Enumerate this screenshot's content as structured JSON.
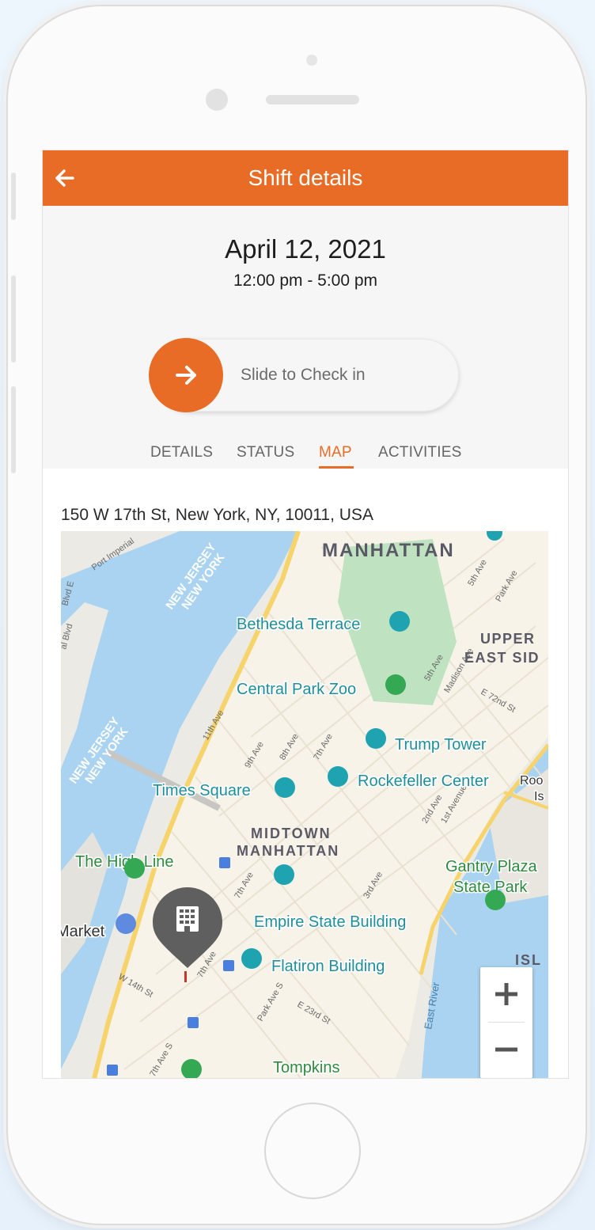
{
  "app": {
    "title": "Shift details",
    "accent_color": "#e86c25"
  },
  "shift": {
    "date": "April 12, 2021",
    "time_range": "12:00 pm - 5:00 pm"
  },
  "check_in": {
    "label": "Slide to Check in",
    "knob_icon": "arrow-right-icon"
  },
  "tabs": [
    {
      "label": "DETAILS",
      "active": false
    },
    {
      "label": "STATUS",
      "active": false
    },
    {
      "label": "MAP",
      "active": true
    },
    {
      "label": "ACTIVITIES",
      "active": false
    }
  ],
  "map": {
    "address": "150 W 17th St, New York, NY, 10011, USA",
    "areas": [
      "MANHATTAN",
      "UPPER",
      "EAST SID",
      "MIDTOWN",
      "MANHATTAN",
      "ISL"
    ],
    "state_labels": [
      "NEW JERSEY",
      "NEW YORK",
      "NEW JERSEY",
      "NEW YORK"
    ],
    "pois": [
      "Bethesda Terrace",
      "Central Park Zoo",
      "Trump Tower",
      "Times Square",
      "Rockefeller Center",
      "The High Line",
      "Gantry Plaza",
      "State Park",
      "Empire State Building",
      "Flatiron Building",
      "Tompkins",
      "Market",
      "Roo",
      "Is"
    ],
    "streets": [
      "Port Imperial",
      "Blvd E",
      "al Blvd",
      "11th Ave",
      "9th Ave",
      "8th Ave",
      "7th Ave",
      "5th Ave",
      "Park Ave",
      "5th Ave",
      "Madison Ave",
      "E 72nd St",
      "2nd Ave",
      "1st Avenue",
      "3rd Ave",
      "7th Ave",
      "W 14th St",
      "7th Ave",
      "Park Ave S",
      "E 23rd St",
      "7th Ave S",
      "East River"
    ],
    "water_color": "#a9d3f0",
    "park_color": "#bfe3c0",
    "marker_icon": "office-building-icon"
  },
  "zoom": {
    "in_label": "+",
    "out_label": "−"
  }
}
